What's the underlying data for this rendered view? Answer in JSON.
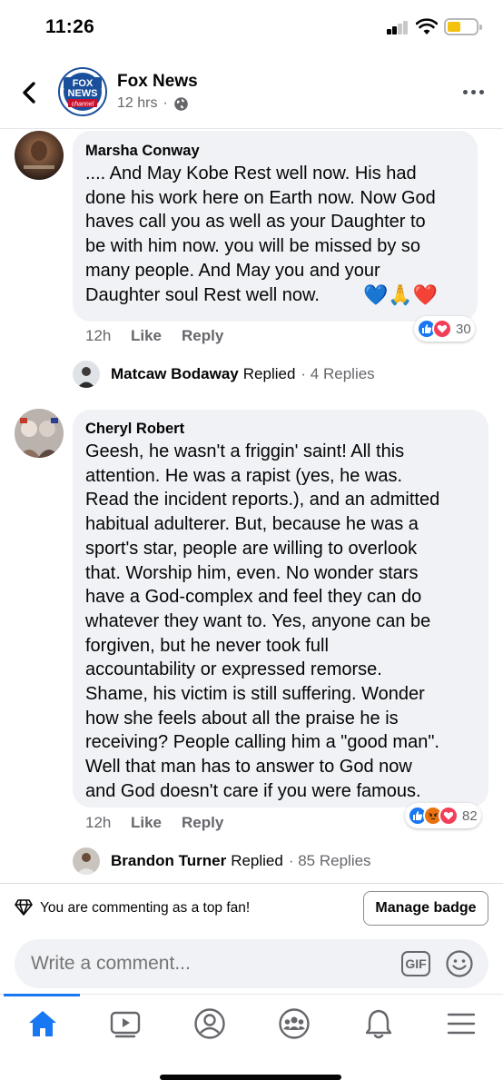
{
  "status_bar": {
    "time": "11:26"
  },
  "header": {
    "page_name": "Fox News",
    "time_ago": "12 hrs",
    "separator": "·",
    "logo": {
      "line1": "FOX",
      "line2": "NEWS",
      "line3": "channel"
    }
  },
  "comments": [
    {
      "author": "Marsha Conway",
      "text": ".... And May Kobe Rest well now. His had\ndone his work here on Earth now. Now God\nhaves call you as well as your Daughter to\nbe with him now. you will be missed by so\nmany people. And May you and your\nDaughter soul Rest well now.",
      "emoji": "💙🙏❤️",
      "time": "12h",
      "like_label": "Like",
      "reply_label": "Reply",
      "reaction_count": "30",
      "reactions": [
        "like-icon",
        "love-icon"
      ],
      "reply_preview": {
        "author": "Matcaw Bodaway",
        "verb": "Replied",
        "count": "· 4 Replies"
      }
    },
    {
      "author": "Cheryl Robert",
      "text": "Geesh, he wasn't a friggin' saint! All this\nattention. He was a rapist (yes, he was.\nRead the incident reports.), and an admitted\nhabitual adulterer. But, because he was a\nsport's star, people are willing to overlook\nthat. Worship him, even. No wonder stars\nhave a God-complex and feel they can do\nwhatever they want to. Yes, anyone can be\nforgiven, but he never took full\naccountability or expressed remorse.\nShame, his victim is still suffering. Wonder\nhow she feels about all the praise he is\nreceiving? People calling him a \"good man\".\nWell that man has to answer to God now\nand God doesn't care if you were famous.",
      "time": "12h",
      "like_label": "Like",
      "reply_label": "Reply",
      "reaction_count": "82",
      "reactions": [
        "like-icon",
        "angry-icon",
        "love-icon"
      ],
      "reply_preview": {
        "author": "Brandon Turner",
        "verb": "Replied",
        "count": "· 85 Replies"
      }
    }
  ],
  "top_fan": {
    "text": "You are commenting as a top fan!",
    "button_label": "Manage badge"
  },
  "composer": {
    "placeholder": "Write a comment...",
    "gif_label": "GIF"
  },
  "tabs": [
    "home-icon",
    "watch-icon",
    "profile-icon",
    "groups-icon",
    "notifications-icon",
    "menu-icon"
  ],
  "colors": {
    "accent": "#1877f2",
    "bubble": "#f0f2f5",
    "secondary_text": "#65676b"
  }
}
